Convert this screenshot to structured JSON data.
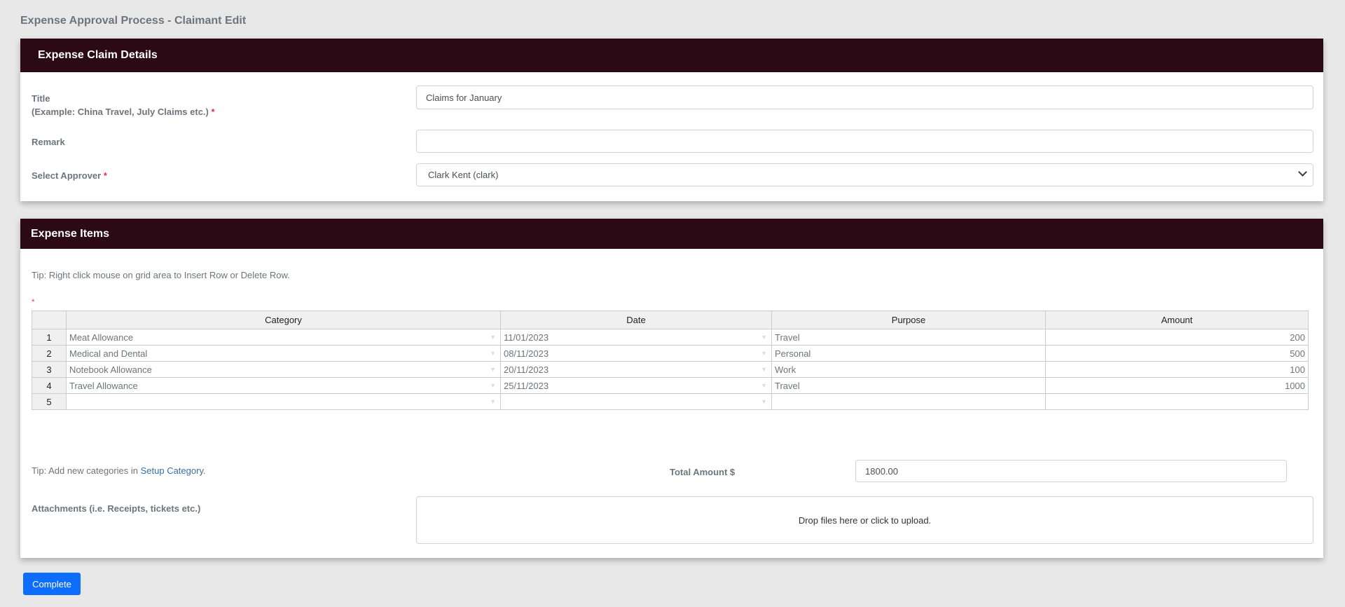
{
  "page_title": "Expense Approval Process - Claimant Edit",
  "claim": {
    "header": "Expense Claim Details",
    "title_label": "Title",
    "title_hint": "(Example: China Travel, July Claims etc.)",
    "required": "*",
    "title_value": "Claims for January",
    "remark_label": "Remark",
    "remark_value": "",
    "approver_label": "Select Approver",
    "approver_value": "Clark Kent (clark)"
  },
  "items": {
    "header": "Expense Items",
    "tip": "Tip: Right click mouse on grid area to Insert Row or Delete Row.",
    "required": "*",
    "columns": [
      "Category",
      "Date",
      "Purpose",
      "Amount"
    ],
    "rows": [
      {
        "n": "1",
        "category": "Meat Allowance",
        "date": "11/01/2023",
        "purpose": "Travel",
        "amount": "200"
      },
      {
        "n": "2",
        "category": "Medical and Dental",
        "date": "08/11/2023",
        "purpose": "Personal",
        "amount": "500"
      },
      {
        "n": "3",
        "category": "Notebook Allowance",
        "date": "20/11/2023",
        "purpose": "Work",
        "amount": "100"
      },
      {
        "n": "4",
        "category": "Travel Allowance",
        "date": "25/11/2023",
        "purpose": "Travel",
        "amount": "1000"
      },
      {
        "n": "5",
        "category": "",
        "date": "",
        "purpose": "",
        "amount": ""
      }
    ],
    "tip2_prefix": "Tip: Add new categories in ",
    "tip2_link": "Setup Category",
    "tip2_suffix": ".",
    "total_label": "Total Amount $",
    "total_value": "1800.00",
    "attach_label": "Attachments (i.e. Receipts, tickets etc.)",
    "drop_text": "Drop files here or click to upload."
  },
  "complete_label": "Complete"
}
